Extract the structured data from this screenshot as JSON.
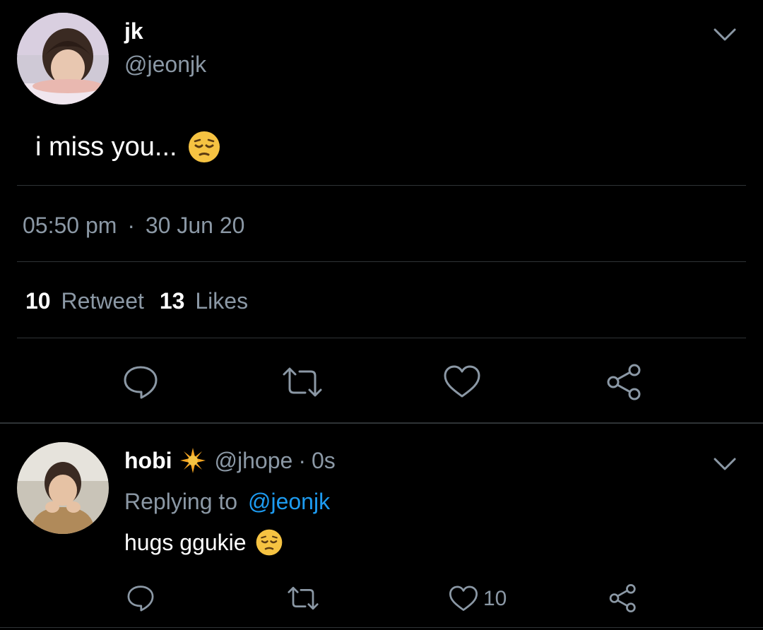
{
  "tweet": {
    "author_name": "jk",
    "author_handle": "@jeonjk",
    "text": "i miss you...",
    "text_emoji": "pensive-face",
    "time": "05:50 pm",
    "separator": "·",
    "date": "30 Jun 20",
    "retweet_count": "10",
    "retweet_label": "Retweet",
    "likes_count": "13",
    "likes_label": "Likes",
    "actions": [
      "reply-icon",
      "retweet-icon",
      "like-icon",
      "share-icon"
    ]
  },
  "reply": {
    "author_name": "hobi",
    "name_emoji": "sparkle",
    "author_handle": "@jhope",
    "separator": "·",
    "time": "0s",
    "replying_label": "Replying to",
    "replying_handle": "@jeonjk",
    "text": "hugs ggukie",
    "text_emoji": "pensive-face",
    "like_count": "10",
    "actions": [
      "reply-icon",
      "retweet-icon",
      "like-icon",
      "share-icon"
    ]
  },
  "colors": {
    "background": "#000000",
    "muted": "#8b98a5",
    "divider": "#2f3336",
    "link": "#1d9bf0",
    "emoji": "#f6c342"
  }
}
